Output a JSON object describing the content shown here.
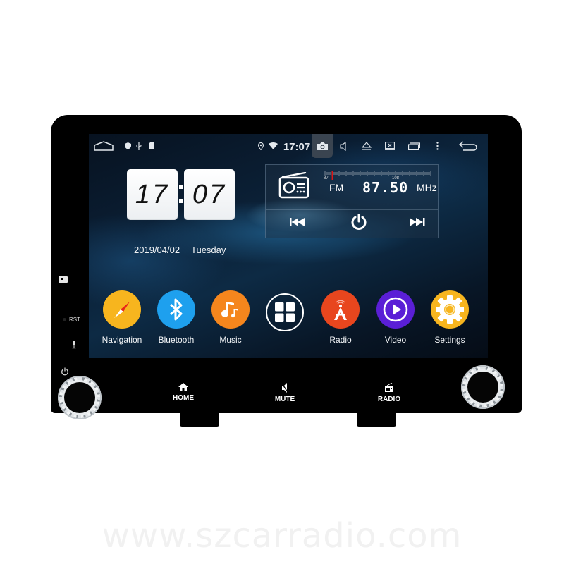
{
  "status_bar": {
    "time": "17:07",
    "left_icons": [
      "home-outline-icon",
      "shield-icon",
      "usb-icon",
      "sd-card-icon"
    ],
    "right_icons": [
      "location-icon",
      "wifi-icon",
      "camera-icon",
      "volume-icon",
      "eject-icon",
      "close-window-icon",
      "recent-apps-icon",
      "overflow-menu-icon",
      "back-icon"
    ]
  },
  "clock_widget": {
    "hours": "17",
    "minutes": "07",
    "date": "2019/04/02",
    "weekday": "Tuesday"
  },
  "radio_widget": {
    "band": "FM",
    "frequency": "87.50",
    "unit": "MHz",
    "scale_min_label": "87",
    "scale_max_label": "108",
    "tuner_position": 0.024,
    "controls": [
      "previous",
      "power",
      "next"
    ]
  },
  "apps": [
    {
      "label": "Navigation",
      "icon": "compass-icon",
      "color": "#f7b51e"
    },
    {
      "label": "Bluetooth",
      "icon": "bluetooth-icon",
      "color": "#1ea0ee"
    },
    {
      "label": "Music",
      "icon": "music-note-icon",
      "color": "#f5861d"
    },
    {
      "label": "",
      "icon": "app-grid-icon",
      "color": "transparent"
    },
    {
      "label": "Radio",
      "icon": "radio-tower-icon",
      "color": "#e8461e"
    },
    {
      "label": "Video",
      "icon": "play-icon",
      "color": "#5a1fd6"
    },
    {
      "label": "Settings",
      "icon": "gear-icon",
      "color": "#f7b51e"
    }
  ],
  "side_panel": {
    "rst_label": "RST"
  },
  "hardware_buttons": [
    {
      "label": "HOME",
      "icon": "home-icon"
    },
    {
      "label": "MUTE",
      "icon": "mute-icon"
    },
    {
      "label": "RADIO",
      "icon": "radio-icon"
    }
  ],
  "watermark": "www.szcarradio.com"
}
